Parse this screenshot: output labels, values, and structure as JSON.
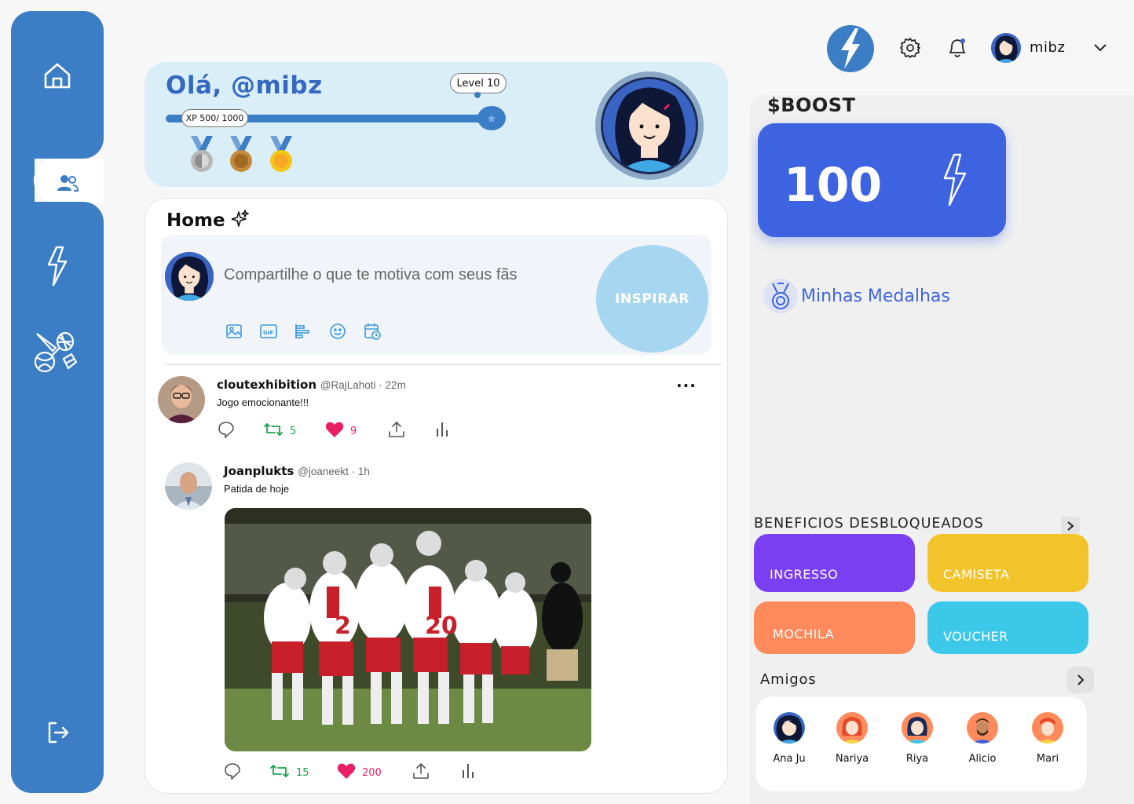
{
  "profile": {
    "greeting": "Olá, @mibz",
    "level": "Level 10",
    "xp": "XP 500/ 1000"
  },
  "header": {
    "username": "mibz"
  },
  "feed": {
    "title": "Home",
    "composer_placeholder": "Compartilhe o que te motiva com seus fãs",
    "inspire_button": "INSPIRAR",
    "posts": [
      {
        "name": "cloutexhibition",
        "handle": "@RajLahoti · 22m",
        "text": "Jogo emocionante!!!",
        "retweets": "5",
        "likes": "9"
      },
      {
        "name": "Joanplukts",
        "handle": "@joaneekt · 1h",
        "text": "Patida de hoje",
        "retweets": "15",
        "likes": "200"
      }
    ]
  },
  "boost": {
    "title": "$BOOST",
    "value": "100"
  },
  "medals_link": "Minhas Medalhas",
  "benefits": {
    "title": "BENEFICIOS DESBLOQUEADOS",
    "items": [
      {
        "label": "INGRESSO",
        "color": "#7b3ff2"
      },
      {
        "label": "CAMISETA",
        "color": "#f2c42c"
      },
      {
        "label": "MOCHILA",
        "color": "#ff8a5c"
      },
      {
        "label": "VOUCHER",
        "color": "#3cc8e8"
      }
    ]
  },
  "friends": {
    "title": "Amigos",
    "items": [
      {
        "name": "Ana Ju"
      },
      {
        "name": "Nariya"
      },
      {
        "name": "Riya"
      },
      {
        "name": "Alicio"
      },
      {
        "name": "Mari"
      }
    ]
  },
  "colors": {
    "primary": "#3c7ec6",
    "boost": "#3e63e0",
    "like": "#e91e63",
    "retweet": "#17a34a"
  }
}
